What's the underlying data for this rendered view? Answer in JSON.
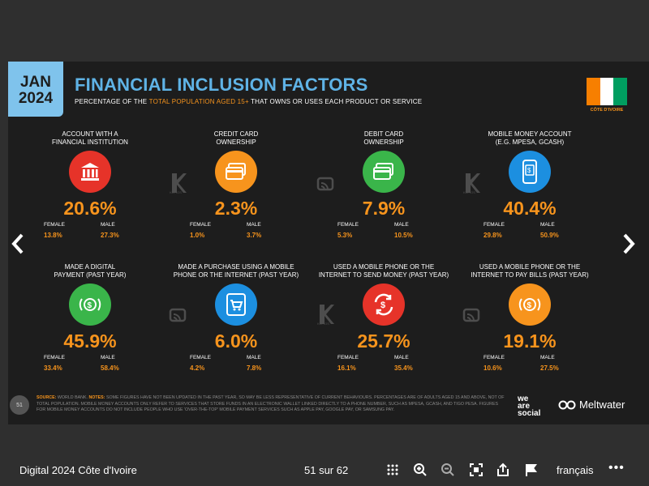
{
  "slide": {
    "date_line1": "JAN",
    "date_line2": "2024",
    "title": "FINANCIAL INCLUSION FACTORS",
    "subtitle_pre": "PERCENTAGE OF THE ",
    "subtitle_highlight": "TOTAL POPULATION AGED 15+",
    "subtitle_post": " THAT OWNS OR USES EACH PRODUCT OR SERVICE",
    "flag_label": "CÔTE D'IVOIRE",
    "flag_colors": [
      "#f77f00",
      "#ffffff",
      "#009e60"
    ],
    "female_label": "FEMALE",
    "male_label": "MALE",
    "cards": [
      {
        "label": "ACCOUNT WITH A\nFINANCIAL INSTITUTION",
        "value": "20.6%",
        "female": "13.8%",
        "male": "27.3%",
        "icon": "bank-icon",
        "color": "#e63329"
      },
      {
        "label": "CREDIT CARD\nOWNERSHIP",
        "value": "2.3%",
        "female": "1.0%",
        "male": "3.7%",
        "icon": "credit-card-icon",
        "color": "#f7941d"
      },
      {
        "label": "DEBIT CARD\nOWNERSHIP",
        "value": "7.9%",
        "female": "5.3%",
        "male": "10.5%",
        "icon": "debit-card-icon",
        "color": "#3ab54a"
      },
      {
        "label": "MOBILE MONEY ACCOUNT\n(E.G. MPESA, GCASH)",
        "value": "40.4%",
        "female": "29.8%",
        "male": "50.9%",
        "icon": "mobile-money-icon",
        "color": "#1c8fe0"
      },
      {
        "label": "MADE A DIGITAL\nPAYMENT (PAST YEAR)",
        "value": "45.9%",
        "female": "33.4%",
        "male": "58.4%",
        "icon": "digital-payment-icon",
        "color": "#3ab54a"
      },
      {
        "label": "MADE A PURCHASE USING A MOBILE\nPHONE OR THE INTERNET (PAST YEAR)",
        "value": "6.0%",
        "female": "4.2%",
        "male": "7.8%",
        "icon": "shopping-cart-icon",
        "color": "#1c8fe0"
      },
      {
        "label": "USED A MOBILE PHONE OR THE\nINTERNET TO SEND MONEY (PAST YEAR)",
        "value": "25.7%",
        "female": "16.1%",
        "male": "35.4%",
        "icon": "send-money-icon",
        "color": "#e63329"
      },
      {
        "label": "USED A MOBILE PHONE OR THE\nINTERNET TO PAY BILLS (PAST YEAR)",
        "value": "19.1%",
        "female": "10.6%",
        "male": "27.5%",
        "icon": "pay-bills-icon",
        "color": "#f7941d"
      }
    ],
    "page_number": "51",
    "source_key": "SOURCE:",
    "source_text": " WORLD BANK. ",
    "notes_key": "NOTES:",
    "notes_text": " SOME FIGURES HAVE NOT BEEN UPDATED IN THE PAST YEAR, SO MAY BE LESS REPRESENTATIVE OF CURRENT BEHAVIOURS. PERCENTAGES ARE OF ADULTS AGED 15 AND ABOVE, NOT OF TOTAL POPULATION. MOBILE MONEY ACCOUNTS ONLY REFER TO SERVICES THAT STORE FUNDS IN AN ELECTRONIC WALLET LINKED DIRECTLY TO A PHONE NUMBER, SUCH AS MPESA, GCASH, AND TIGO PESA. FIGURES FOR MOBILE MONEY ACCOUNTS DO NOT INCLUDE PEOPLE WHO USE 'OVER-THE-TOP' MOBILE PAYMENT SERVICES SUCH AS APPLE PAY, GOOGLE PAY, OR SAMSUNG PAY.",
    "brand1_line1": "we",
    "brand1_line2": "are",
    "brand1_line3": "social",
    "brand2": "Meltwater",
    "watermark_label": "KEPIOS"
  },
  "toolbar": {
    "doc_title": "Digital 2024 Côte d'Ivoire",
    "page_count": "51 sur 62",
    "language": "français",
    "more": "•••"
  }
}
